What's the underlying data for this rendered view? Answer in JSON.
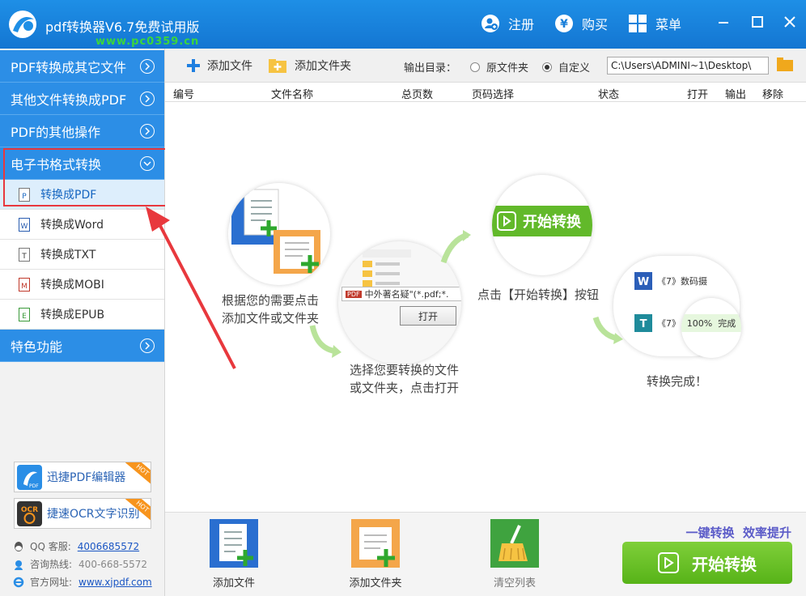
{
  "titlebar": {
    "title": "pdf转换器V6.7免费试用版",
    "watermark": "www.pc0359.cn",
    "register": "注册",
    "buy": "购买",
    "menu": "菜单"
  },
  "sidebar": {
    "categories": [
      {
        "label": "PDF转换成其它文件"
      },
      {
        "label": "其他文件转换成PDF"
      },
      {
        "label": "PDF的其他操作"
      },
      {
        "label": "电子书格式转换"
      },
      {
        "label": "特色功能"
      }
    ],
    "subitems": [
      {
        "label": "转换成PDF",
        "icon": "P"
      },
      {
        "label": "转换成Word",
        "icon": "W"
      },
      {
        "label": "转换成TXT",
        "icon": "T"
      },
      {
        "label": "转换成MOBI",
        "icon": "M"
      },
      {
        "label": "转换成EPUB",
        "icon": "E"
      }
    ],
    "promos": [
      {
        "label": "迅捷PDF编辑器",
        "badge": "HOT"
      },
      {
        "label": "捷速OCR文字识别",
        "badge": "HOT"
      }
    ],
    "contact": {
      "qq_label": "QQ 客服:",
      "qq_value": "4006685572",
      "hotline_label": "咨询热线:",
      "hotline_value": "400-668-5572",
      "site_label": "官方网址:",
      "site_value": "www.xjpdf.com"
    }
  },
  "toolbar": {
    "add_file": "添加文件",
    "add_folder": "添加文件夹",
    "output_label": "输出目录：",
    "radio_original": "原文件夹",
    "radio_custom": "自定义",
    "path": "C:\\Users\\ADMINI~1\\Desktop\\"
  },
  "columns": [
    "编号",
    "文件名称",
    "总页数",
    "页码选择",
    "状态",
    "打开",
    "输出",
    "移除"
  ],
  "guide": {
    "step1": "根据您的需要点击\n添加文件或文件夹",
    "step2": "选择您要转换的文件\n或文件夹，点击打开",
    "step3": "点击【开始转换】按钮",
    "step4": "转换完成！",
    "dialog_filename": "中外著名疑\"(*.pdf;*.",
    "dialog_open": "打开",
    "start_badge": "开始转换",
    "doc1": "《7》数码摄",
    "doc2": "《7》",
    "progress": "100%",
    "done": "完成"
  },
  "bottom": {
    "add_file": "添加文件",
    "add_folder": "添加文件夹",
    "clear_list": "清空列表",
    "slogan": "一键转换  效率提升",
    "start": "开始转换"
  },
  "colors": {
    "primary": "#2c8ee6",
    "green": "#6cc12a",
    "highlight": "#e8383d"
  }
}
